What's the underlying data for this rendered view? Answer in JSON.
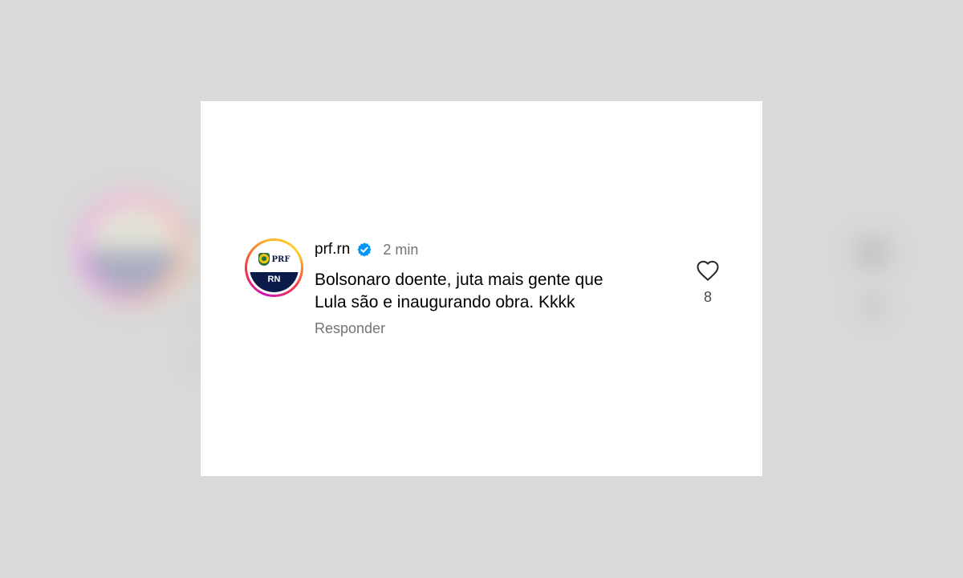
{
  "comment": {
    "username": "prf.rn",
    "timestamp": "2 min",
    "text_lines": [
      "Bolsonaro doente, juta mais gente que",
      "Lula são e inaugurando obra. Kkkk"
    ],
    "reply_label": "Responder",
    "like_count": "8",
    "verified": true
  },
  "avatar": {
    "top_text": "PRF",
    "band_text": "RN"
  },
  "icons": {
    "verified": "verified-badge-icon",
    "like": "heart-outline-icon"
  },
  "colors": {
    "verified_blue": "#0095f6",
    "secondary_text": "#737373",
    "avatar_navy": "#0b1a48"
  }
}
